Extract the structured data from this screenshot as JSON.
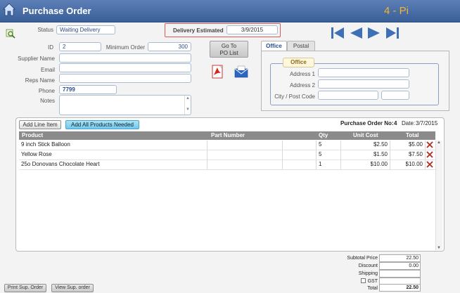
{
  "header": {
    "title": "Purchase Order",
    "right_text": "4 - Pi"
  },
  "status": {
    "label": "Status",
    "value": "Waiting Delivery"
  },
  "delivery": {
    "label": "Delivery Estimated",
    "value": "3/9/2015"
  },
  "id": {
    "label": "ID",
    "value": "2"
  },
  "min_order": {
    "label": "Minimum Order",
    "value": "300"
  },
  "supplier": {
    "label": "Supplier Name",
    "value": ""
  },
  "email": {
    "label": "Email",
    "value": ""
  },
  "reps": {
    "label": "Reps Name",
    "value": ""
  },
  "phone": {
    "label": "Phone",
    "value": "7799"
  },
  "notes": {
    "label": "Notes",
    "value": ""
  },
  "goto_btn": {
    "line1": "Go To",
    "line2": "PO List"
  },
  "address": {
    "tabs": [
      "Office",
      "Postal"
    ],
    "group": "Office",
    "labels": {
      "address1": "Address 1",
      "address2": "Address 2",
      "city": "City / Post Code"
    }
  },
  "items": {
    "add_line": "Add Line Item",
    "add_all": "Add All Products Needed",
    "po_label": "Purchase Order No:",
    "po_number": "4",
    "date_label": "Date:",
    "date_value": "3/7/2015",
    "columns": {
      "product": "Product",
      "part": "Part Number",
      "qty": "Qty",
      "unit": "Unit Cost",
      "total": "Total"
    },
    "rows": [
      {
        "product": "9 inch Stick Balloon",
        "part": "",
        "qty": "5",
        "unit": "$2.50",
        "total": "$5.00"
      },
      {
        "product": "Yellow Rose",
        "part": "",
        "qty": "5",
        "unit": "$1.50",
        "total": "$7.50"
      },
      {
        "product": "25o Donovans Chocolate Heart",
        "part": "",
        "qty": "1",
        "unit": "$10.00",
        "total": "$10.00"
      }
    ]
  },
  "totals": {
    "subtotal_label": "Subtotal Price",
    "subtotal": "22.50",
    "discount_label": "Discount",
    "discount": "0.00",
    "shipping_label": "Shipping",
    "shipping": "",
    "gst_label": "GST",
    "gst": "",
    "total_label": "Total",
    "total": "22.50"
  },
  "bottom": {
    "print": "Print Sup. Order",
    "view": "View Sup. order"
  },
  "colors": {
    "header": "#3a5f98",
    "accent": "#f3b52e",
    "delivery_border": "#d75b5b",
    "delete": "#c0392b"
  },
  "icons": [
    "home-icon",
    "search-icon",
    "first-icon",
    "prev-icon",
    "next-icon",
    "last-icon",
    "pdf-icon",
    "mail-icon",
    "delete-icon"
  ]
}
